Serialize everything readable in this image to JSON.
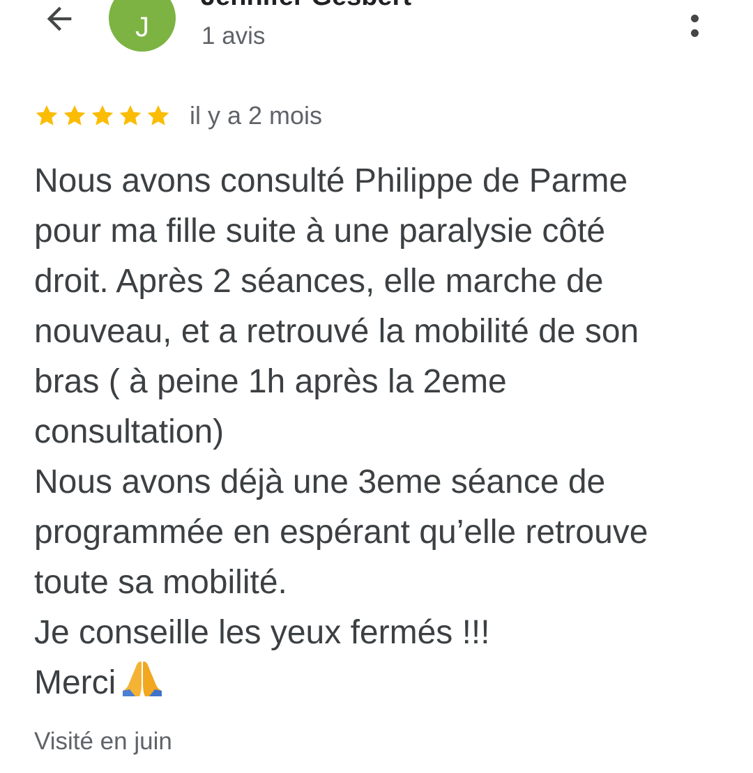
{
  "header": {
    "back_icon": "arrow-back-icon",
    "avatar_letter": "J",
    "avatar_color": "#7cb342",
    "author_name": "Jennifer Gesbert",
    "review_count": "1 avis",
    "more_icon": "more-vert-icon"
  },
  "review": {
    "rating": 5,
    "rating_max": 5,
    "star_color": "#fbbc04",
    "date": "il y a 2 mois",
    "lines": [
      "Nous avons consulté Philippe de Parme",
      "pour ma fille suite à une paralysie côté",
      "droit. Après 2 séances, elle marche de",
      "nouveau, et a retrouvé la mobilité de son",
      "bras ( à peine 1h après la 2eme",
      "consultation)",
      "Nous avons déjà une 3eme séance de",
      "programmée en espérant qu’elle retrouve",
      "toute sa mobilité.",
      "Je conseille les yeux fermés !!!",
      "Merci"
    ],
    "closing_emoji": "folded-hands-emoji",
    "visited": "Visité en juin"
  }
}
